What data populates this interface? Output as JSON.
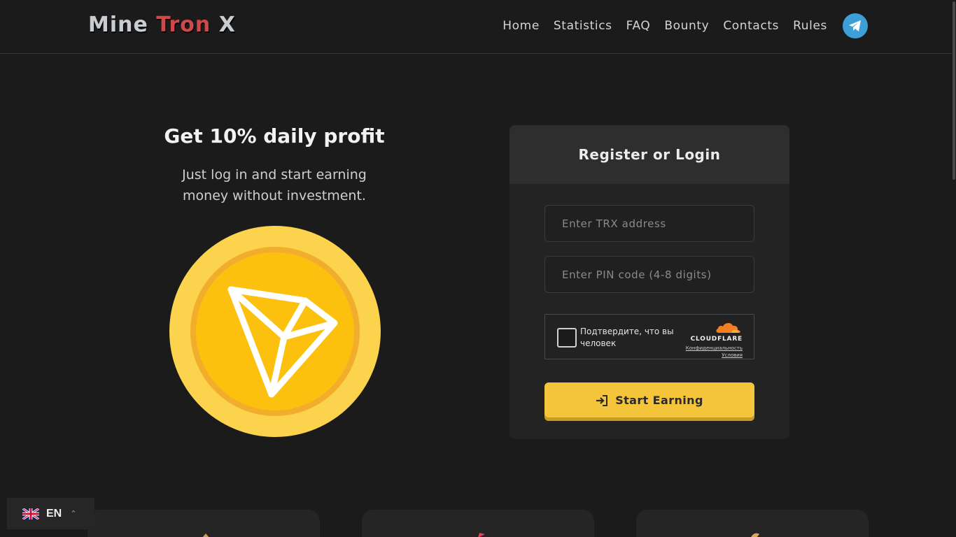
{
  "brand": {
    "part1": "Mine",
    "part2": "Tron",
    "part3": "X"
  },
  "nav": {
    "items": [
      "Home",
      "Statistics",
      "FAQ",
      "Bounty",
      "Contacts",
      "Rules"
    ],
    "telegram_icon": "telegram-icon"
  },
  "hero": {
    "title": "Get 10% daily profit",
    "subtitle_line1": "Just log in and start earning",
    "subtitle_line2": "money without investment.",
    "coin_icon": "tron-coin-icon"
  },
  "login": {
    "heading": "Register or Login",
    "address_placeholder": "Enter TRX address",
    "address_value": "",
    "pin_placeholder": "Enter PIN code (4-8 digits)",
    "pin_value": "",
    "captcha": {
      "label_line1": "Подтвердите, что вы",
      "label_line2": "человек",
      "provider": "CLOUDFLARE",
      "privacy": "Конфиденциальность",
      "terms": "Условия"
    },
    "submit_label": "Start Earning",
    "submit_icon": "sign-in-icon"
  },
  "language": {
    "code": "EN",
    "flag": "uk-flag-icon"
  },
  "colors": {
    "background": "#1b1b1b",
    "accent": "#f4c43b",
    "brand_red": "#d2484a",
    "telegram": "#3d9fd8"
  }
}
